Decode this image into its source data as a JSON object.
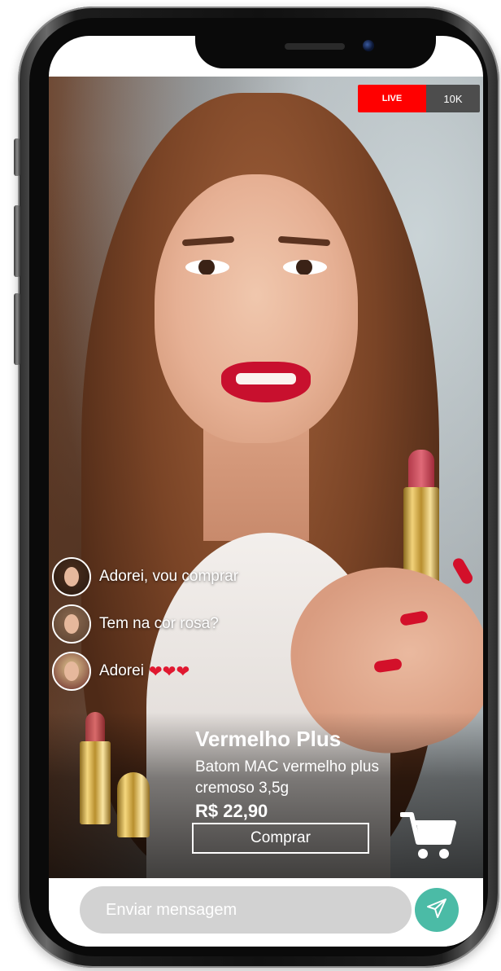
{
  "live": {
    "badge_label": "LIVE",
    "viewer_count": "10K",
    "badge_color": "#ff0000"
  },
  "chat": {
    "messages": [
      {
        "text": "Adorei, vou comprar",
        "avatar_icon": "user-avatar"
      },
      {
        "text": "Tem na cor rosa?",
        "avatar_icon": "user-avatar"
      },
      {
        "text": "Adorei",
        "avatar_icon": "user-avatar",
        "emoji": "❤❤❤"
      }
    ]
  },
  "product": {
    "name": "Vermelho Plus",
    "description": "Batom MAC vermelho plus cremoso 3,5g",
    "price": "R$ 22,90",
    "buy_label": "Comprar"
  },
  "message_bar": {
    "placeholder": "Enviar mensagem",
    "send_icon": "send-icon",
    "send_color": "#4bbba6"
  },
  "icons": {
    "cart": "shopping-cart-icon"
  }
}
